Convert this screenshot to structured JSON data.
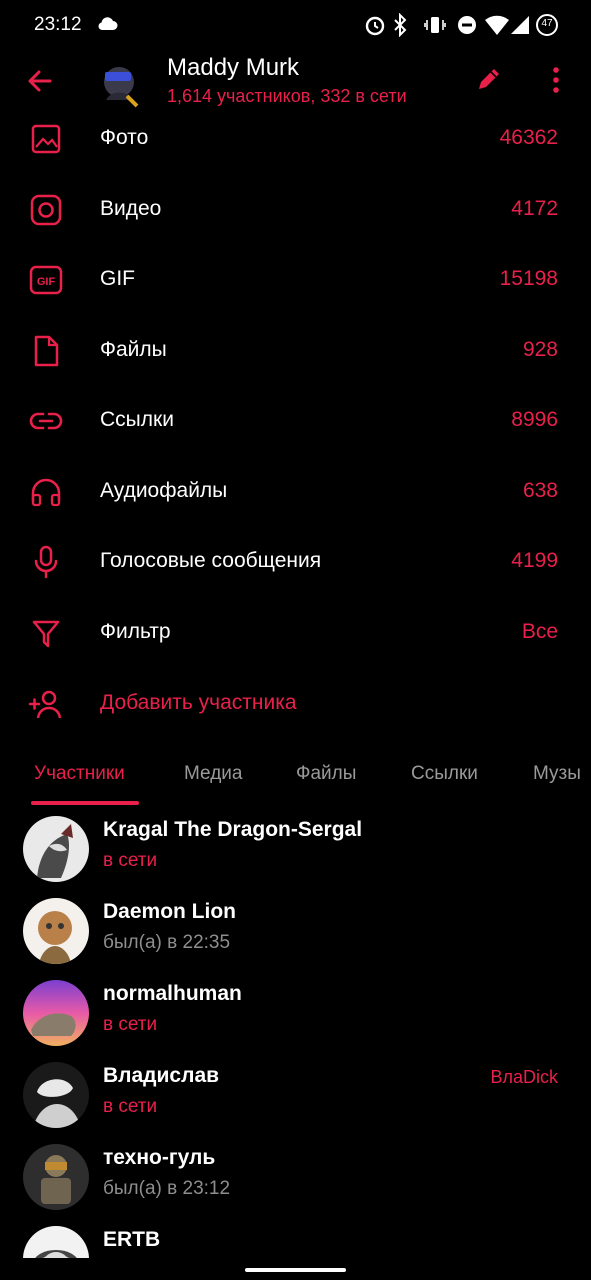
{
  "status_bar": {
    "time": "23:12",
    "battery": "47"
  },
  "header": {
    "title": "Maddy Murk",
    "subtitle": "1,614 участников, 332 в сети"
  },
  "menu": [
    {
      "icon": "photo-icon",
      "label": "Фото",
      "count": "46362"
    },
    {
      "icon": "video-icon",
      "label": "Видео",
      "count": "4172"
    },
    {
      "icon": "gif-icon",
      "label": "GIF",
      "count": "15198"
    },
    {
      "icon": "file-icon",
      "label": "Файлы",
      "count": "928"
    },
    {
      "icon": "link-icon",
      "label": "Ссылки",
      "count": "8996"
    },
    {
      "icon": "headphones-icon",
      "label": "Аудиофайлы",
      "count": "638"
    },
    {
      "icon": "microphone-icon",
      "label": "Голосовые сообщения",
      "count": "4199"
    },
    {
      "icon": "filter-icon",
      "label": "Фильтр",
      "count": "Все"
    }
  ],
  "add_member": {
    "icon": "add-user-icon",
    "label": "Добавить участника"
  },
  "tabs": [
    "Участники",
    "Медиа",
    "Файлы",
    "Ссылки",
    "Музы"
  ],
  "members": [
    {
      "name": "Kragal The Dragon-Sergal",
      "status": "в сети",
      "online": true,
      "tag": ""
    },
    {
      "name": "Daemon Lion",
      "status": "был(а) в 22:35",
      "online": false,
      "tag": ""
    },
    {
      "name": "normalhuman",
      "status": "в сети",
      "online": true,
      "tag": ""
    },
    {
      "name": "Владислав",
      "status": "в сети",
      "online": true,
      "tag": "ВлаDick"
    },
    {
      "name": "техно-гуль",
      "status": "был(а) в 23:12",
      "online": false,
      "tag": ""
    },
    {
      "name": "ERTB",
      "status": "",
      "online": false,
      "tag": ""
    }
  ],
  "colors": {
    "accent": "#e8204a",
    "background": "#000000",
    "muted": "#8e8e8e"
  }
}
